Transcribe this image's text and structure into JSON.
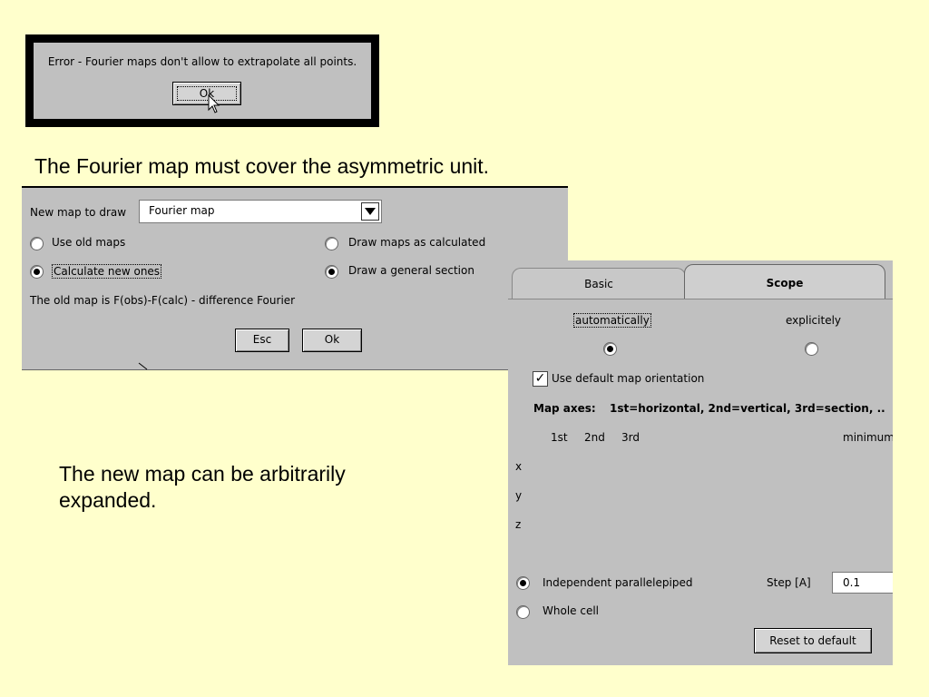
{
  "error_dialog": {
    "message": "Error - Fourier maps don't allow to extrapolate all points.",
    "ok_label": "Ok"
  },
  "captions": {
    "top": "The Fourier map must cover the asymmetric unit.",
    "bottom": "The new map can be arbitrarily expanded."
  },
  "map_dialog": {
    "new_map_label": "New map to draw",
    "map_type": "Fourier map",
    "use_old_maps": "Use old maps",
    "calculate_new": "Calculate new ones",
    "draw_as_calculated": "Draw maps as calculated",
    "draw_general_section": "Draw a general section",
    "old_map_info": "The old map is F(obs)-F(calc) - difference Fourier",
    "esc_label": "Esc",
    "ok_label": "Ok",
    "calculate_new_selected": true,
    "draw_general_selected": true
  },
  "scope_dialog": {
    "tabs": [
      "Basic",
      "Scope"
    ],
    "active_tab": "Scope",
    "automatically": "automatically",
    "explicitely": "explicitely",
    "use_default_orientation": "Use default map orientation",
    "map_axes": "Map axes:",
    "map_axes_desc": "1st=horizontal, 2nd=vertical, 3rd=section, ..",
    "col_1st": "1st",
    "col_2nd": "2nd",
    "col_3rd": "3rd",
    "col_minimum": "minimum",
    "row_x": "x",
    "row_y": "y",
    "row_z": "z",
    "independent": "Independent parallelepiped",
    "whole_cell": "Whole cell",
    "step_label": "Step [A]",
    "step_value": "0.1",
    "reset_label": "Reset to default"
  }
}
